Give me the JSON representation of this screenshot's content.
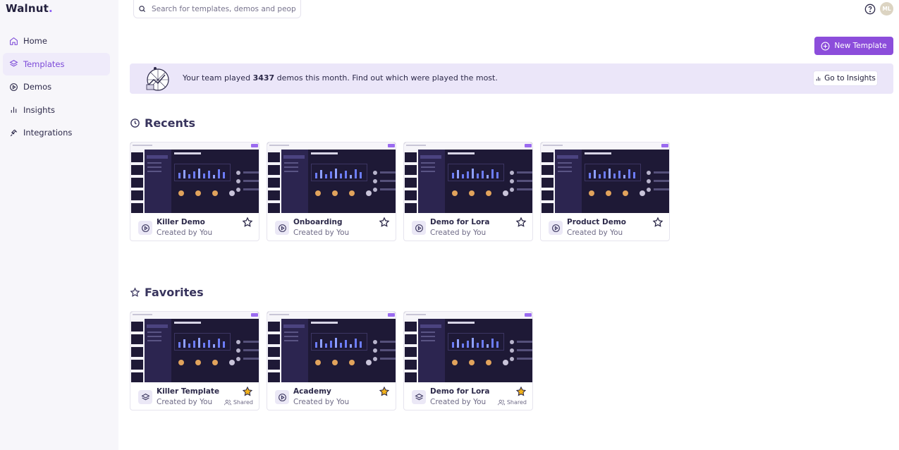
{
  "brand": {
    "name": "Walnut",
    "dot": "."
  },
  "sidebar": {
    "items": [
      {
        "label": "Home",
        "icon": "home-icon",
        "active": false
      },
      {
        "label": "Templates",
        "icon": "layers-icon",
        "active": true
      },
      {
        "label": "Demos",
        "icon": "play-circle-icon",
        "active": false
      },
      {
        "label": "Insights",
        "icon": "bar-chart-icon",
        "active": false
      },
      {
        "label": "Integrations",
        "icon": "plug-icon",
        "active": false
      }
    ]
  },
  "header": {
    "search_placeholder": "Search for templates, demos and people",
    "avatar_initials": "ML",
    "new_button": "New Template"
  },
  "banner": {
    "text_before": "Your team played ",
    "count": "3437",
    "text_after": " demos this month. Find out which were played the most.",
    "button": "Go to Insights"
  },
  "recents": {
    "title": "Recents",
    "cards": [
      {
        "title": "Killer Demo",
        "subtitle": "Created by You",
        "type": "demo",
        "starred": false
      },
      {
        "title": "Onboarding",
        "subtitle": "Created by You",
        "type": "demo",
        "starred": false
      },
      {
        "title": "Demo for Lora",
        "subtitle": "Created by You",
        "type": "demo",
        "starred": false
      },
      {
        "title": "Product Demo",
        "subtitle": "Created by You",
        "type": "demo",
        "starred": false
      }
    ]
  },
  "favorites": {
    "title": "Favorites",
    "cards": [
      {
        "title": "Killer Template",
        "subtitle": "Created by You",
        "type": "template",
        "starred": true,
        "shared": "Shared"
      },
      {
        "title": "Academy",
        "subtitle": "Created by You",
        "type": "demo",
        "starred": true
      },
      {
        "title": "Demo for Lora",
        "subtitle": "Created by You",
        "type": "template",
        "starred": true,
        "shared": "Shared"
      }
    ]
  },
  "colors": {
    "accent": "#8c4ddb",
    "star": "#f2b21b",
    "banner": "#ebe6f9"
  }
}
